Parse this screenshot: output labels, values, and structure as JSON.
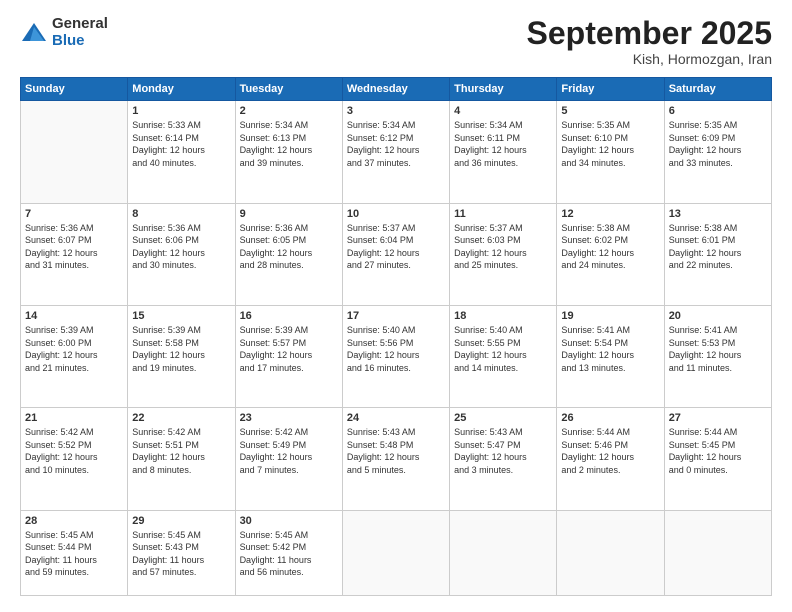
{
  "logo": {
    "general": "General",
    "blue": "Blue"
  },
  "header": {
    "month": "September 2025",
    "location": "Kish, Hormozgan, Iran"
  },
  "weekdays": [
    "Sunday",
    "Monday",
    "Tuesday",
    "Wednesday",
    "Thursday",
    "Friday",
    "Saturday"
  ],
  "weeks": [
    [
      {
        "day": "",
        "info": ""
      },
      {
        "day": "1",
        "info": "Sunrise: 5:33 AM\nSunset: 6:14 PM\nDaylight: 12 hours\nand 40 minutes."
      },
      {
        "day": "2",
        "info": "Sunrise: 5:34 AM\nSunset: 6:13 PM\nDaylight: 12 hours\nand 39 minutes."
      },
      {
        "day": "3",
        "info": "Sunrise: 5:34 AM\nSunset: 6:12 PM\nDaylight: 12 hours\nand 37 minutes."
      },
      {
        "day": "4",
        "info": "Sunrise: 5:34 AM\nSunset: 6:11 PM\nDaylight: 12 hours\nand 36 minutes."
      },
      {
        "day": "5",
        "info": "Sunrise: 5:35 AM\nSunset: 6:10 PM\nDaylight: 12 hours\nand 34 minutes."
      },
      {
        "day": "6",
        "info": "Sunrise: 5:35 AM\nSunset: 6:09 PM\nDaylight: 12 hours\nand 33 minutes."
      }
    ],
    [
      {
        "day": "7",
        "info": "Sunrise: 5:36 AM\nSunset: 6:07 PM\nDaylight: 12 hours\nand 31 minutes."
      },
      {
        "day": "8",
        "info": "Sunrise: 5:36 AM\nSunset: 6:06 PM\nDaylight: 12 hours\nand 30 minutes."
      },
      {
        "day": "9",
        "info": "Sunrise: 5:36 AM\nSunset: 6:05 PM\nDaylight: 12 hours\nand 28 minutes."
      },
      {
        "day": "10",
        "info": "Sunrise: 5:37 AM\nSunset: 6:04 PM\nDaylight: 12 hours\nand 27 minutes."
      },
      {
        "day": "11",
        "info": "Sunrise: 5:37 AM\nSunset: 6:03 PM\nDaylight: 12 hours\nand 25 minutes."
      },
      {
        "day": "12",
        "info": "Sunrise: 5:38 AM\nSunset: 6:02 PM\nDaylight: 12 hours\nand 24 minutes."
      },
      {
        "day": "13",
        "info": "Sunrise: 5:38 AM\nSunset: 6:01 PM\nDaylight: 12 hours\nand 22 minutes."
      }
    ],
    [
      {
        "day": "14",
        "info": "Sunrise: 5:39 AM\nSunset: 6:00 PM\nDaylight: 12 hours\nand 21 minutes."
      },
      {
        "day": "15",
        "info": "Sunrise: 5:39 AM\nSunset: 5:58 PM\nDaylight: 12 hours\nand 19 minutes."
      },
      {
        "day": "16",
        "info": "Sunrise: 5:39 AM\nSunset: 5:57 PM\nDaylight: 12 hours\nand 17 minutes."
      },
      {
        "day": "17",
        "info": "Sunrise: 5:40 AM\nSunset: 5:56 PM\nDaylight: 12 hours\nand 16 minutes."
      },
      {
        "day": "18",
        "info": "Sunrise: 5:40 AM\nSunset: 5:55 PM\nDaylight: 12 hours\nand 14 minutes."
      },
      {
        "day": "19",
        "info": "Sunrise: 5:41 AM\nSunset: 5:54 PM\nDaylight: 12 hours\nand 13 minutes."
      },
      {
        "day": "20",
        "info": "Sunrise: 5:41 AM\nSunset: 5:53 PM\nDaylight: 12 hours\nand 11 minutes."
      }
    ],
    [
      {
        "day": "21",
        "info": "Sunrise: 5:42 AM\nSunset: 5:52 PM\nDaylight: 12 hours\nand 10 minutes."
      },
      {
        "day": "22",
        "info": "Sunrise: 5:42 AM\nSunset: 5:51 PM\nDaylight: 12 hours\nand 8 minutes."
      },
      {
        "day": "23",
        "info": "Sunrise: 5:42 AM\nSunset: 5:49 PM\nDaylight: 12 hours\nand 7 minutes."
      },
      {
        "day": "24",
        "info": "Sunrise: 5:43 AM\nSunset: 5:48 PM\nDaylight: 12 hours\nand 5 minutes."
      },
      {
        "day": "25",
        "info": "Sunrise: 5:43 AM\nSunset: 5:47 PM\nDaylight: 12 hours\nand 3 minutes."
      },
      {
        "day": "26",
        "info": "Sunrise: 5:44 AM\nSunset: 5:46 PM\nDaylight: 12 hours\nand 2 minutes."
      },
      {
        "day": "27",
        "info": "Sunrise: 5:44 AM\nSunset: 5:45 PM\nDaylight: 12 hours\nand 0 minutes."
      }
    ],
    [
      {
        "day": "28",
        "info": "Sunrise: 5:45 AM\nSunset: 5:44 PM\nDaylight: 11 hours\nand 59 minutes."
      },
      {
        "day": "29",
        "info": "Sunrise: 5:45 AM\nSunset: 5:43 PM\nDaylight: 11 hours\nand 57 minutes."
      },
      {
        "day": "30",
        "info": "Sunrise: 5:45 AM\nSunset: 5:42 PM\nDaylight: 11 hours\nand 56 minutes."
      },
      {
        "day": "",
        "info": ""
      },
      {
        "day": "",
        "info": ""
      },
      {
        "day": "",
        "info": ""
      },
      {
        "day": "",
        "info": ""
      }
    ]
  ]
}
